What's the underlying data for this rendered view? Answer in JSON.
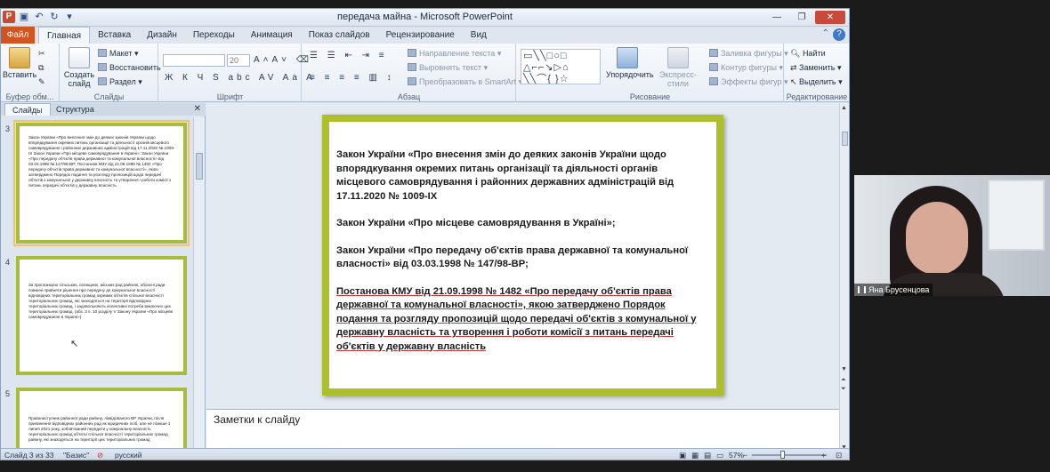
{
  "window": {
    "title": "передача майна - Microsoft PowerPoint",
    "app_logo": "P"
  },
  "ribbon_tabs": [
    "Главная",
    "Вставка",
    "Дизайн",
    "Переходы",
    "Анимация",
    "Показ слайдов",
    "Рецензирование",
    "Вид"
  ],
  "file_tab": "Файл",
  "ribbon": {
    "clipboard": {
      "paste": "Вставить",
      "label": "Буфер обм..."
    },
    "slides": {
      "new_slide": "Создать слайд",
      "layout": "Макет",
      "reset": "Восстановить",
      "section": "Раздел",
      "label": "Слайды"
    },
    "font": {
      "size": "20",
      "label": "Шрифт"
    },
    "paragraph": {
      "text_direction": "Направление текста",
      "align_text": "Выровнять текст",
      "smartart": "Преобразовать в SmartArt",
      "label": "Абзац"
    },
    "drawing": {
      "arrange": "Упорядочить",
      "quick_styles": "Экспресс-стили",
      "fill": "Заливка фигуры",
      "outline": "Контур фигуры",
      "effects": "Эффекты фигур",
      "label": "Рисование"
    },
    "editing": {
      "find": "Найти",
      "replace": "Заменить",
      "select": "Выделить",
      "label": "Редактирование"
    }
  },
  "left_pane": {
    "tabs": [
      "Слайды",
      "Структура"
    ],
    "thumbnails": [
      {
        "number": "3",
        "text": "Закон України «Про внесення змін до деяких законів України щодо впорядкування окремих питань організації та діяльності органів місцевого самоврядування і районних державних адміністрацій від 17.11.2020 № 1009-IX  Закон України «Про місцеве самоврядування в Україні»;  Закон України «Про передачу об'єктів права державної та комунальної власності» від 03.03.1998 № 147/98-ВР;  Постанова КМУ від 21.09.1998 № 1482 «Про передачу об'єктів права державної та комунальної власності», якою затверджено Порядок подання та розгляду пропозицій щодо передачі об'єктів з комунальної у державну власність та утворення і роботи комісії з питань передачі об'єктів у державну власність"
      },
      {
        "number": "4",
        "text": "За пропозицією сільських, селищних, міських рад районні, обласні ради повинні прийняти рішення про передачу до комунальної власності відповідних територіальних громад окремих об'єктів спільної власності територіальних громад, які знаходяться на території відповідних територіальних громад, і задовольняють колективні потреби виключно цих територіальних громад.   (абз. 3 п. 10 розділу V Закону України «Про місцеве самоврядування в Україні»)"
      },
      {
        "number": "5",
        "text": "Правонаступник районної ради району, ліквідованого ВР України, після припинення відповідних районних рад як юридичних осіб, але не пізніше 1 липня 2021 року, зобов'язаний передати у комунальну власність територіальних громад об'єкти спільної власності територіальних громад району, які знаходяться на території цих територіальних громад"
      }
    ]
  },
  "slide": {
    "paragraphs": [
      "Закон України «Про внесення змін до деяких законів України щодо впорядкування окремих питань організації та діяльності органів місцевого самоврядування і районних державних адміністрацій від 17.11.2020 № 1009-IX",
      "Закон України «Про місцеве самоврядування в Україні»;",
      "Закон України «Про передачу об'єктів права державної та комунальної власності» від 03.03.1998 № 147/98-ВР;",
      "Постанова КМУ від 21.09.1998 № 1482 «Про передачу об'єктів права державної та комунальної власності», якою затверджено Порядок подання та розгляду пропозицій щодо передачі об'єктів з комунальної у державну власність та утворення і роботи комісії з питань передачі об'єктів у державну власність"
    ]
  },
  "notes": {
    "placeholder": "Заметки к слайду"
  },
  "statusbar": {
    "slide_info": "Слайд 3 из 33",
    "theme": "\"Базис\"",
    "language": "русский",
    "zoom": "57%"
  },
  "webcam": {
    "name": "Яна Брусенцова"
  },
  "colors": {
    "slide_border": "#adbf2a",
    "file_tab": "#d2541f"
  }
}
